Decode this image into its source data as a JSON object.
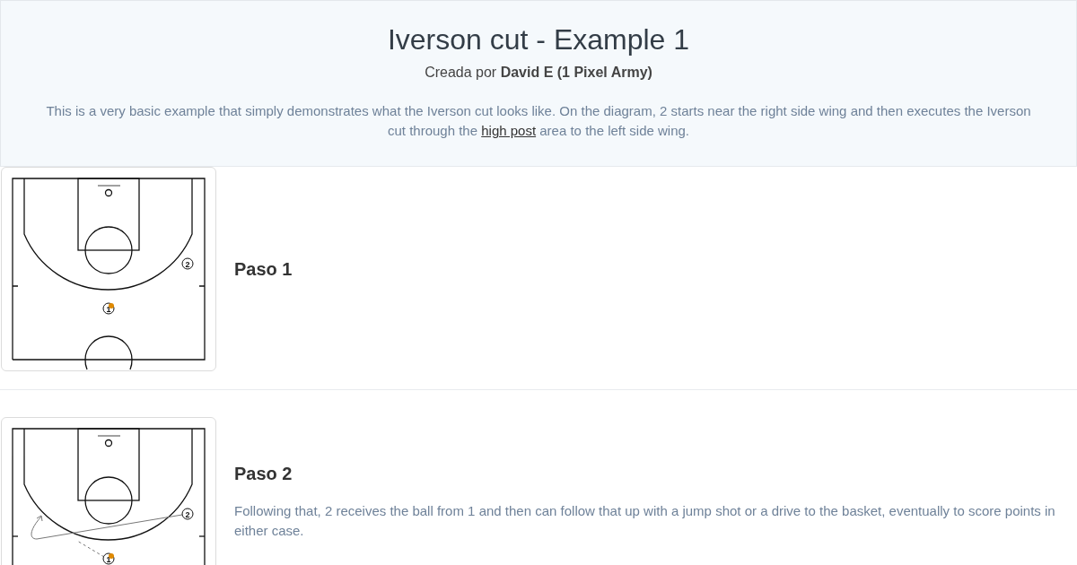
{
  "play": {
    "title": "Iverson cut - Example 1",
    "byline_prefix": "Creada por",
    "author": "David E (1 Pixel Army)",
    "description_before": "This is a very basic example that simply demonstrates what the Iverson cut looks like. On the diagram, 2 starts near the right side wing and then executes the Iverson cut through the ",
    "description_link": "high post",
    "description_after": " area to the left side wing."
  },
  "steps": [
    {
      "title": "Paso 1",
      "players": [
        {
          "label": "1",
          "has_ball": true
        },
        {
          "label": "2",
          "has_ball": false
        }
      ]
    },
    {
      "title": "Paso 2",
      "text": "Following that, 2 receives the ball from 1 and then can follow that up with a jump shot or a drive to the basket, eventually to score points in either case.",
      "players": [
        {
          "label": "1",
          "has_ball": true
        },
        {
          "label": "2",
          "has_ball": false
        }
      ],
      "actions": [
        {
          "kind": "cut"
        },
        {
          "kind": "pass"
        }
      ]
    }
  ]
}
